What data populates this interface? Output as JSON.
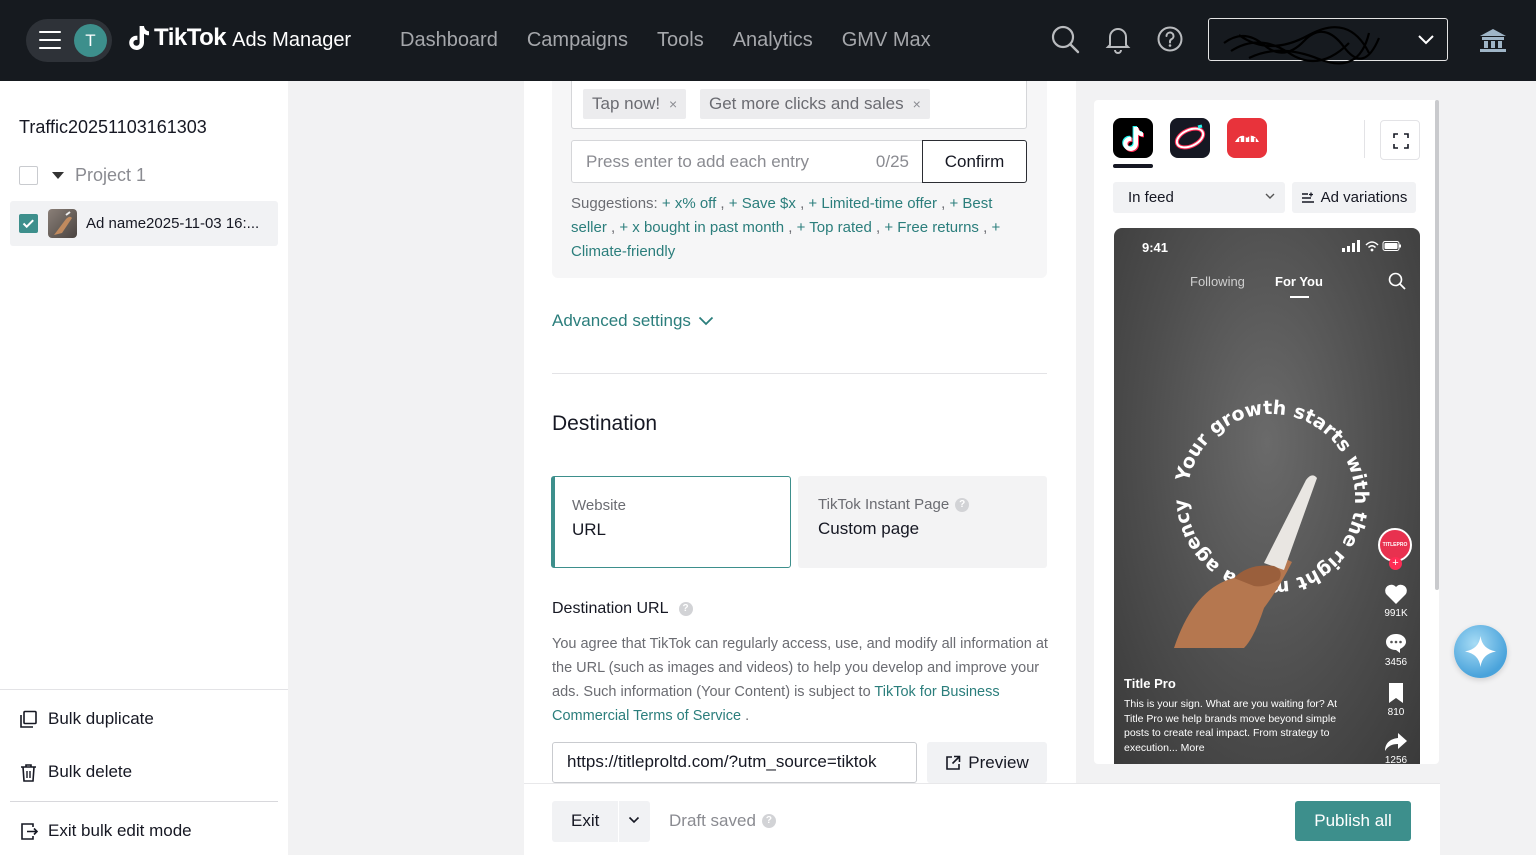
{
  "topbar": {
    "avatar_initial": "T",
    "brand_main": "TikTok",
    "brand_sub": "Ads Manager",
    "nav": [
      "Dashboard",
      "Campaigns",
      "Tools",
      "Analytics",
      "GMV Max"
    ]
  },
  "sidebar": {
    "campaign_name": "Traffic20251103161303",
    "project_label": "Project 1",
    "ad_label": "Ad name2025-11-03 16:...",
    "actions": {
      "bulk_duplicate": "Bulk duplicate",
      "bulk_delete": "Bulk delete",
      "exit_bulk": "Exit bulk edit mode"
    }
  },
  "form": {
    "tags": [
      "Tap now!",
      "Get more clicks and sales"
    ],
    "tag_remove_glyph": "×",
    "entry_placeholder": "Press enter to add each entry",
    "entry_count": "0/25",
    "confirm_label": "Confirm",
    "suggestions_label": "Suggestions:",
    "suggestions": [
      "+ x% off",
      "+ Save $x",
      "+ Limited-time offer",
      "+ Best seller",
      "+ x bought in past month",
      "+ Top rated",
      "+ Free returns",
      "+ Climate-friendly"
    ],
    "advanced_settings": "Advanced settings",
    "destination_title": "Destination",
    "destination_options": [
      {
        "sub": "Website",
        "main": "URL",
        "selected": true
      },
      {
        "sub": "TikTok Instant Page",
        "main": "Custom page",
        "selected": false
      }
    ],
    "destination_url_label": "Destination URL",
    "url_desc_text": "You agree that TikTok can regularly access, use, and modify all information at the URL (such as images and videos) to help you develop and improve your ads. Such information (Your Content) is subject to",
    "url_desc_link": "TikTok for Business Commercial Terms of Service",
    "url_desc_end": ".",
    "url_value": "https://titleproltd.com/?utm_source=tiktok",
    "preview_label": "Preview"
  },
  "footer": {
    "exit_label": "Exit",
    "draft_status": "Draft saved",
    "publish_label": "Publish all"
  },
  "preview": {
    "placement": "In feed",
    "variations": "Ad variations",
    "phone": {
      "time": "9:41",
      "tab_following": "Following",
      "tab_foryou": "For You",
      "circle_text": "Your growth starts with the right media agency",
      "creator_badge": "TITLEPRO",
      "likes": "991K",
      "comments": "3456",
      "saves": "810",
      "shares": "1256",
      "caption_title": "Title Pro",
      "caption": "This is your sign. What are you waiting for? At Title Pro we help brands move beyond simple posts to create real impact. From strategy to execution... More"
    }
  },
  "colors": {
    "accent": "#3d8f8c",
    "link": "#2b7e7c",
    "topbar": "#161a1f"
  }
}
